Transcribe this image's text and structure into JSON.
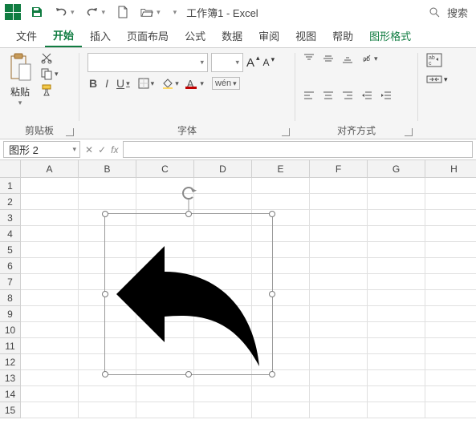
{
  "title_bar": {
    "doc_title": "工作簿1 - Excel",
    "search_placeholder": "搜索"
  },
  "tabs": {
    "file": "文件",
    "home": "开始",
    "insert": "插入",
    "layout": "页面布局",
    "formulas": "公式",
    "data": "数据",
    "review": "审阅",
    "view": "视图",
    "help": "帮助",
    "shape_format": "图形格式"
  },
  "ribbon": {
    "clipboard": {
      "paste": "粘贴",
      "label": "剪贴板"
    },
    "font": {
      "label": "字体",
      "bold": "B",
      "italic": "I",
      "underline": "U",
      "wen": "wén",
      "size_up": "A",
      "size_down": "A"
    },
    "align": {
      "label": "对齐方式"
    }
  },
  "name_box": "图形 2",
  "fx": {
    "cancel": "✕",
    "enter": "✓",
    "fx": "fx"
  },
  "columns": [
    "A",
    "B",
    "C",
    "D",
    "E",
    "F",
    "G",
    "H"
  ],
  "rows": [
    "1",
    "2",
    "3",
    "4",
    "5",
    "6",
    "7",
    "8",
    "9",
    "10",
    "11",
    "12",
    "13",
    "14",
    "15"
  ]
}
